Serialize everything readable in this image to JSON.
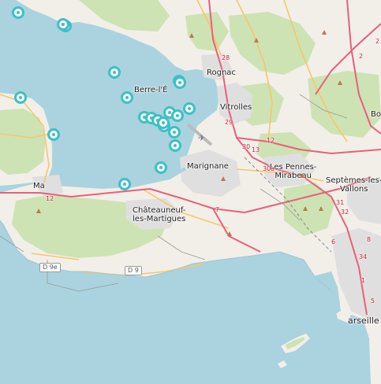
{
  "map": {
    "place_labels": [
      {
        "id": "rognac",
        "text": "Rognac"
      },
      {
        "id": "berre",
        "text": "Berre-l'É"
      },
      {
        "id": "vitrolles",
        "text": "Vitrolles"
      },
      {
        "id": "marignane",
        "text": "Marignane"
      },
      {
        "id": "les-pennes",
        "text": "Les Pennes-\nMirabeau"
      },
      {
        "id": "septemes",
        "text": "Septèmes-les-\nVallons"
      },
      {
        "id": "chateauneuf",
        "text": "Châteauneuf-\nles-Martigues"
      },
      {
        "id": "martigues",
        "text": "Ma"
      },
      {
        "id": "bo",
        "text": "Bo"
      },
      {
        "id": "marseille",
        "text": "arseille"
      }
    ],
    "road_shields": [
      {
        "id": "d9e",
        "text": "D 9e"
      },
      {
        "id": "d9",
        "text": "D 9"
      }
    ],
    "road_numbers": [
      {
        "id": "r28",
        "text": "28"
      },
      {
        "id": "r2a",
        "text": "2"
      },
      {
        "id": "r29",
        "text": "29"
      },
      {
        "id": "r30",
        "text": "30"
      },
      {
        "id": "r13",
        "text": "13"
      },
      {
        "id": "r12",
        "text": "12"
      },
      {
        "id": "r30a",
        "text": "30a"
      },
      {
        "id": "r7",
        "text": "7"
      },
      {
        "id": "r12b",
        "text": "12"
      },
      {
        "id": "r31",
        "text": "31"
      },
      {
        "id": "r6",
        "text": "6"
      },
      {
        "id": "r32",
        "text": "32"
      },
      {
        "id": "r34",
        "text": "34"
      },
      {
        "id": "r8",
        "text": "8"
      },
      {
        "id": "r2b",
        "text": "2"
      },
      {
        "id": "r1",
        "text": "1"
      },
      {
        "id": "r5",
        "text": "5"
      }
    ],
    "marker_count": 21,
    "colors": {
      "water": "#aad3df",
      "land": "#f2efe9",
      "forest": "#cde3b4",
      "urban": "#e0dfdf",
      "road_primary": "#e8607a",
      "road_secondary": "#f6c66e",
      "marker": "#3cc0c6"
    }
  }
}
